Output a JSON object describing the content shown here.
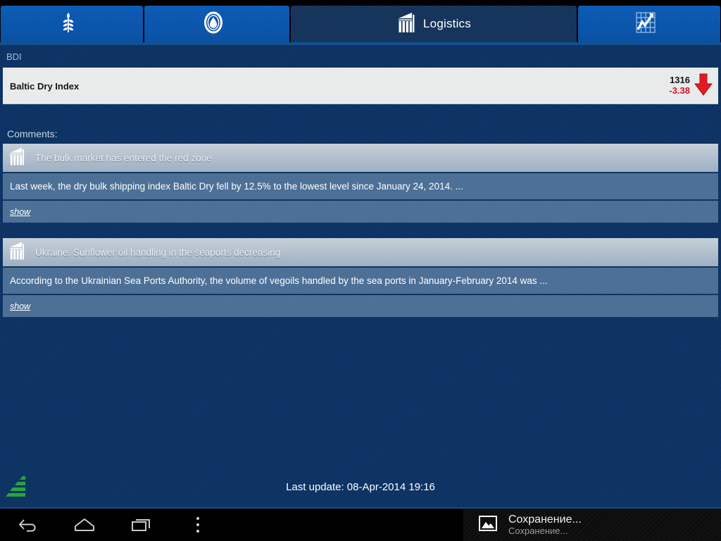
{
  "tabs": [
    {
      "id": "grain",
      "label": "",
      "icon": "wheat-icon",
      "active": false
    },
    {
      "id": "oil",
      "label": "",
      "icon": "oil-drop-icon",
      "active": false
    },
    {
      "id": "logistics",
      "label": "Logistics",
      "icon": "grain-silo-icon",
      "active": true
    },
    {
      "id": "quotes",
      "label": "",
      "icon": "line-chart-icon",
      "active": false
    }
  ],
  "section": {
    "label": "BDI"
  },
  "quote": {
    "name": "Baltic Dry Index",
    "value": "1316",
    "change": "-3.38",
    "direction_icon": "down-arrow-icon",
    "change_color": "#d4142a"
  },
  "comments": {
    "label": "Comments:",
    "items": [
      {
        "icon": "grain-silo-icon",
        "title": "The bulk market has entered the red zone",
        "body": "Last week, the dry bulk shipping index Baltic Dry fell by 12.5% to the lowest level since January 24, 2014. ...",
        "show_label": "show"
      },
      {
        "icon": "grain-silo-icon",
        "title": "Ukraine. Sunflower oil handling in the seaports decreasing",
        "body": "According to the Ukrainian Sea Ports Authority, the volume of vegoils handled by the sea ports in January-February 2014 was ...",
        "show_label": "show"
      }
    ]
  },
  "footer": {
    "logo_icon": "green-sail-logo",
    "last_update": "Last update: 08-Apr-2014 19:16"
  },
  "system_bar": {
    "back_icon": "back-arrow-icon",
    "home_icon": "home-icon",
    "recents_icon": "recent-apps-icon",
    "menu_icon": "overflow-menu-icon",
    "notification": {
      "icon": "image-icon",
      "title": "Сохранение...",
      "subtitle": "Сохранение..."
    }
  },
  "theme": {
    "background": "#0c3363",
    "tab_active": "#15345c",
    "tab_inactive": "#0b56ad",
    "card_light": "#e9eaea",
    "row_body": "#4c6f96",
    "logo_green": "#2aa33f"
  }
}
